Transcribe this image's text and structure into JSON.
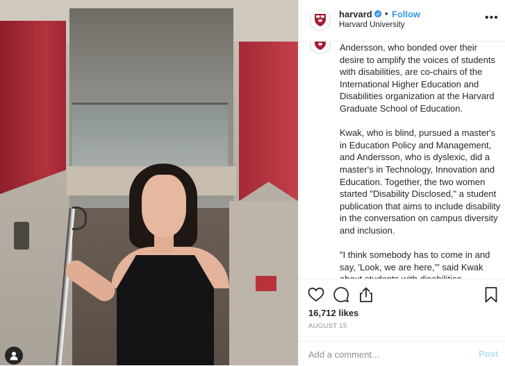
{
  "photo": {
    "banner_left_text": "",
    "user_tag_icon": "user-tag-icon"
  },
  "header": {
    "username": "harvard",
    "verified_icon": "verified-badge-icon",
    "separator": "•",
    "follow_label": "Follow",
    "subtitle": "Harvard University",
    "more_icon": "more-options-icon"
  },
  "caption": {
    "paragraphs": [
      "Andersson, who bonded over their desire to amplify the voices of students with disabilities, are co-chairs of the International Higher Education and Disabilities organization at the Harvard Graduate School of Education.",
      "Kwak, who is blind, pursued a master's in Education Policy and Management, and Andersson, who is dyslexic, did a master's in Technology, Innovation and Education. Together, the two women started \"Disability Disclosed,\" a student publication that aims to include disability in the conversation on campus diversity and inclusion.",
      "\"I think somebody has to come in and say, 'Look, we are here,'\" said Kwak about students with disabilities."
    ]
  },
  "actions": {
    "like_icon": "heart-icon",
    "comment_icon": "comment-icon",
    "share_icon": "share-icon",
    "save_icon": "bookmark-icon",
    "likes": "16,712 likes",
    "date": "AUGUST 15"
  },
  "comment": {
    "placeholder": "Add a comment...",
    "post_label": "Post"
  },
  "colors": {
    "link": "#3897f0",
    "post_disabled": "#b2dffc",
    "harvard_crimson": "#a51c30"
  }
}
